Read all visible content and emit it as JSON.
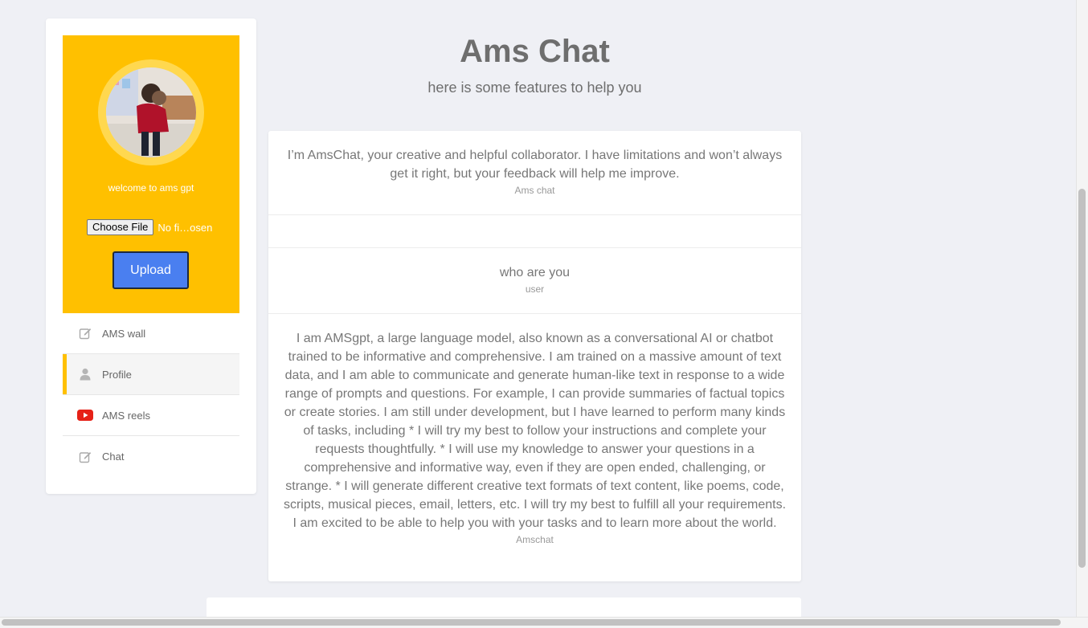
{
  "sidebar": {
    "welcome": "welcome to ams gpt",
    "file_button": "Choose File",
    "file_status": "No fi…osen",
    "upload_label": "Upload",
    "nav": [
      {
        "label": "AMS wall",
        "icon": "edit-icon"
      },
      {
        "label": "Profile",
        "icon": "user-icon"
      },
      {
        "label": "AMS reels",
        "icon": "youtube-icon"
      },
      {
        "label": "Chat",
        "icon": "edit-icon"
      }
    ]
  },
  "main": {
    "title": "Ams Chat",
    "subtitle": "here is some features to help you",
    "messages": [
      {
        "text": "I’m AmsChat, your creative and helpful collaborator. I have limitations and won’t always get it right, but your feedback will help me improve.",
        "sender": "Ams chat"
      },
      {
        "text": "",
        "sender": ""
      },
      {
        "text": "who are you",
        "sender": "user"
      },
      {
        "text": "I am AMSgpt, a large language model, also known as a conversational AI or chatbot trained to be informative and comprehensive. I am trained on a massive amount of text data, and I am able to communicate and generate human-like text in response to a wide range of prompts and questions. For example, I can provide summaries of factual topics or create stories. I am still under development, but I have learned to perform many kinds of tasks, including * I will try my best to follow your instructions and complete your requests thoughtfully. * I will use my knowledge to answer your questions in a comprehensive and informative way, even if they are open ended, challenging, or strange. * I will generate different creative text formats of text content, like poems, code, scripts, musical pieces, email, letters, etc. I will try my best to fulfill all your requirements. I am excited to be able to help you with your tasks and to learn more about the world.",
        "sender": "Amschat"
      }
    ]
  },
  "colors": {
    "accent_yellow": "#ffc000",
    "upload_blue": "#4a7ff0",
    "background": "#eff0f5",
    "youtube_red": "#e62117"
  }
}
